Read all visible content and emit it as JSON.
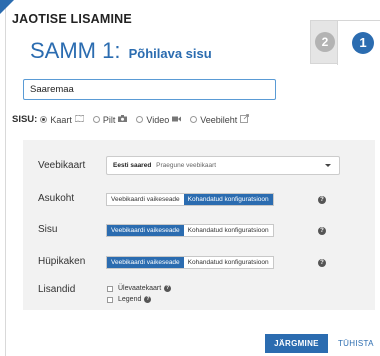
{
  "header": {
    "title": "JAOTISE LISAMINE",
    "step_title": "SAMM 1:",
    "step_subtitle": "Põhilava sisu"
  },
  "steps": [
    {
      "number": "2",
      "active": false
    },
    {
      "number": "1",
      "active": true
    }
  ],
  "name_input": {
    "value": "Saaremaa"
  },
  "content": {
    "label": "SISU:",
    "options": [
      {
        "label": "Kaart",
        "icon": "map-icon",
        "selected": true
      },
      {
        "label": "Pilt",
        "icon": "camera-icon",
        "selected": false
      },
      {
        "label": "Video",
        "icon": "video-icon",
        "selected": false
      },
      {
        "label": "Veebileht",
        "icon": "external-link-icon",
        "selected": false
      }
    ]
  },
  "config": {
    "webmap": {
      "label": "Veebikaart",
      "selected": "Eesti saared",
      "hint": "Praegune veebikaart"
    },
    "location": {
      "label": "Asukoht",
      "options": [
        "Veebikaardi vaikeseade",
        "Kohandatud konfiguratsioon"
      ],
      "active_index": 1
    },
    "content": {
      "label": "Sisu",
      "options": [
        "Veebikaardi vaikeseade",
        "Kohandatud konfiguratsioon"
      ],
      "active_index": 0
    },
    "popup": {
      "label": "Hüpikaken",
      "options": [
        "Veebikaardi vaikeseade",
        "Kohandatud konfiguratsioon"
      ],
      "active_index": 0
    },
    "extras": {
      "label": "Lisandid",
      "items": [
        {
          "label": "Ülevaatekaart",
          "checked": false
        },
        {
          "label": "Legend",
          "checked": false
        }
      ]
    }
  },
  "footer": {
    "next_label": "JÄRGMINE",
    "cancel_label": "TÜHISTA"
  },
  "colors": {
    "accent": "#2b6cb0",
    "panel_bg": "#f2f2f2"
  }
}
